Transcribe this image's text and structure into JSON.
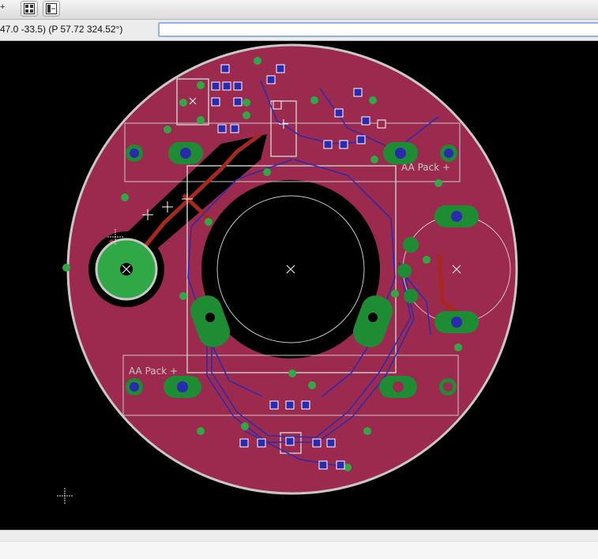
{
  "toolbar": {
    "first_glyph": "+",
    "buttons": [
      {
        "name": "layout-grid-icon"
      },
      {
        "name": "layout-split-icon"
      }
    ]
  },
  "coords": {
    "text": "47.0 -33.5) (P 57.72 324.52°)",
    "command_value": "",
    "command_placeholder": ""
  },
  "board": {
    "label_top": "AA Pack +",
    "label_bottom": "AA Pack +"
  },
  "colors": {
    "copper_top": "#9c2a4f",
    "copper_bottom": "#2a2ab0",
    "pad": "#1e8c32",
    "via": "#2fa845",
    "silk": "#c8c8c8",
    "canvas": "#000000",
    "trace_top": "#a8281e"
  }
}
